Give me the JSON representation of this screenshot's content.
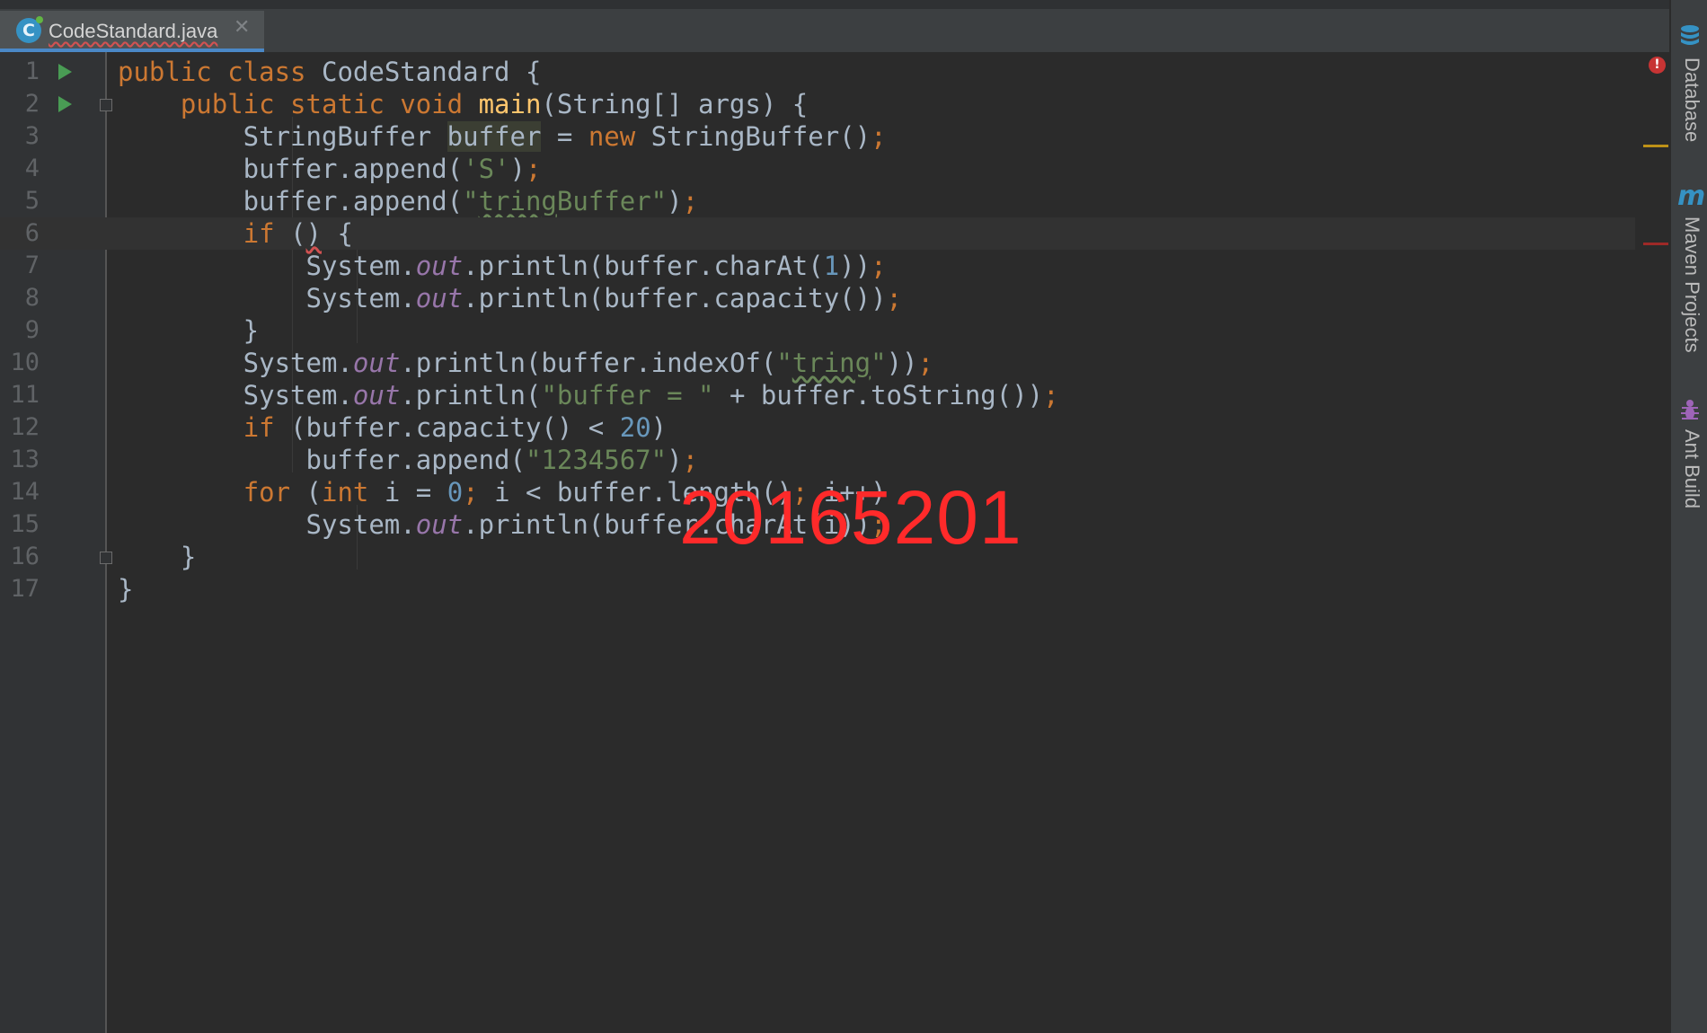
{
  "tab": {
    "filename": "CodeStandard.java",
    "icon": "java-class-icon",
    "icon_letter": "C",
    "close_symbol": "✕"
  },
  "editor": {
    "line_numbers": [
      "1",
      "2",
      "3",
      "4",
      "5",
      "6",
      "7",
      "8",
      "9",
      "10",
      "11",
      "12",
      "13",
      "14",
      "15",
      "16",
      "17"
    ],
    "current_line": 6
  },
  "overlay": {
    "watermark": "20165201",
    "watermark_color": "#ff2a2a"
  },
  "error_stripe": {
    "error_symbol": "!",
    "error_color": "#c73434",
    "warning_color": "#be9117"
  },
  "tool_windows": [
    {
      "label": "Database",
      "icon": "database-icon"
    },
    {
      "label": "Maven Projects",
      "icon": "maven-icon",
      "icon_text": "m"
    },
    {
      "label": "Ant Build",
      "icon": "ant-icon"
    }
  ],
  "colors": {
    "background": "#2b2b2b",
    "keyword": "#cc7832",
    "string": "#6a8759",
    "number": "#6897bb",
    "field": "#9876aa",
    "method_decl": "#ffc66d",
    "text": "#a9b7c6"
  }
}
